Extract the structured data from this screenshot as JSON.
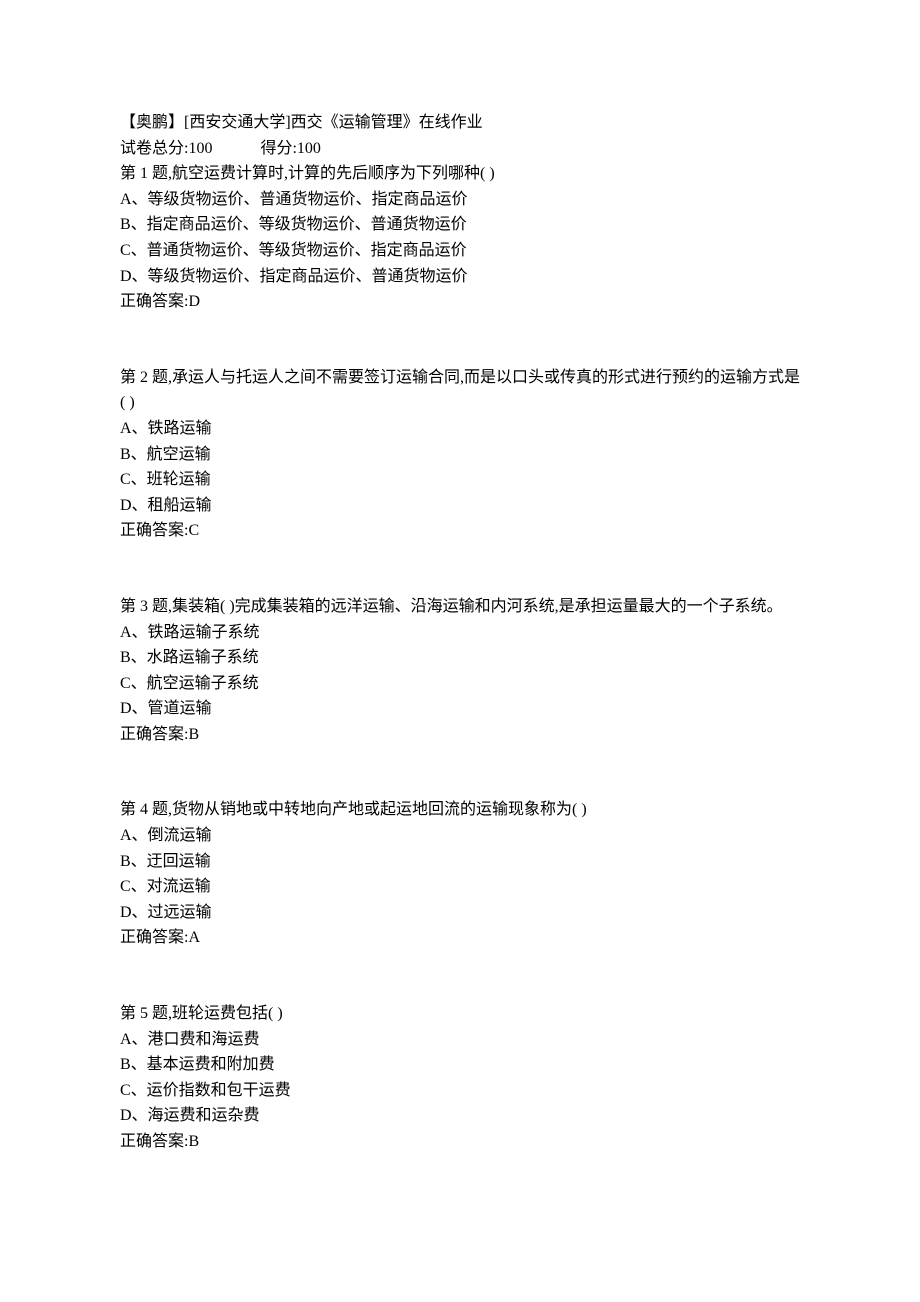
{
  "header": {
    "title": "【奥鹏】[西安交通大学]西交《运输管理》在线作业",
    "total_label": "试卷总分:",
    "total_value": "100",
    "score_label": "得分:",
    "score_value": "100"
  },
  "questions": [
    {
      "prompt": "第 1 题,航空运费计算时,计算的先后顺序为下列哪种( )",
      "options": [
        "A、等级货物运价、普通货物运价、指定商品运价",
        "B、指定商品运价、等级货物运价、普通货物运价",
        "C、普通货物运价、等级货物运价、指定商品运价",
        "D、等级货物运价、指定商品运价、普通货物运价"
      ],
      "answer": "正确答案:D"
    },
    {
      "prompt": "第 2 题,承运人与托运人之间不需要签订运输合同,而是以口头或传真的形式进行预约的运输方式是( )",
      "options": [
        "A、铁路运输",
        "B、航空运输",
        "C、班轮运输",
        "D、租船运输"
      ],
      "answer": "正确答案:C"
    },
    {
      "prompt": "第 3 题,集装箱( )完成集装箱的远洋运输、沿海运输和内河系统,是承担运量最大的一个子系统。",
      "options": [
        "A、铁路运输子系统",
        "B、水路运输子系统",
        "C、航空运输子系统",
        "D、管道运输"
      ],
      "answer": "正确答案:B"
    },
    {
      "prompt": "第 4 题,货物从销地或中转地向产地或起运地回流的运输现象称为( )",
      "options": [
        "A、倒流运输",
        "B、迂回运输",
        "C、对流运输",
        "D、过远运输"
      ],
      "answer": "正确答案:A"
    },
    {
      "prompt": "第 5 题,班轮运费包括( )",
      "options": [
        "A、港口费和海运费",
        "B、基本运费和附加费",
        "C、运价指数和包干运费",
        "D、海运费和运杂费"
      ],
      "answer": "正确答案:B"
    }
  ]
}
